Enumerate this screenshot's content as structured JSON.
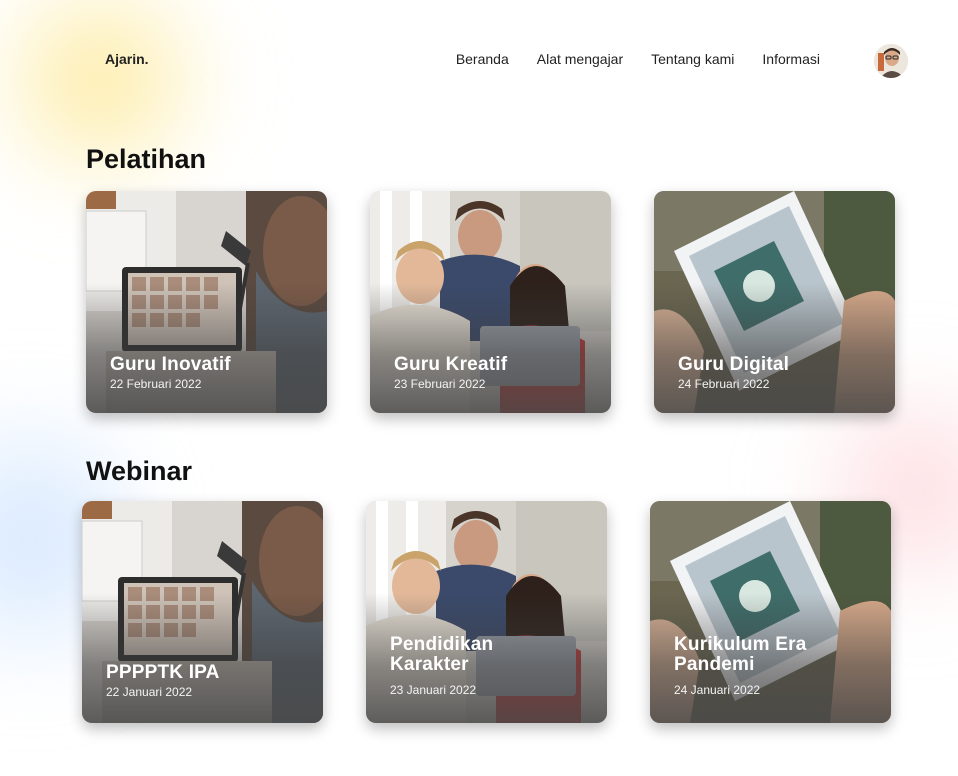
{
  "nav": {
    "logo": "Ajarin.",
    "items": [
      {
        "label": "Beranda"
      },
      {
        "label": "Alat mengajar"
      },
      {
        "label": "Tentang kami"
      },
      {
        "label": "Informasi"
      }
    ]
  },
  "pelatihan": {
    "title": "Pelatihan",
    "cards": [
      {
        "title": "Guru Inovatif",
        "date": "22 Februari 2022",
        "scene": "laptop-video-call"
      },
      {
        "title": "Guru Kreatif",
        "date": "23 Februari 2022",
        "scene": "students-laptop"
      },
      {
        "title": "Guru Digital",
        "date": "24 Februari 2022",
        "scene": "hands-tablet"
      }
    ]
  },
  "webinar": {
    "title": "Webinar",
    "cards": [
      {
        "title": "PPPPTK IPA",
        "date": "22 Januari 2022",
        "scene": "laptop-video-call"
      },
      {
        "title": "Pendidikan\nKarakter",
        "date": "23 Januari 2022",
        "scene": "students-laptop"
      },
      {
        "title": "Kurikulum Era\nPandemi",
        "date": "24 Januari 2022",
        "scene": "hands-tablet"
      }
    ]
  }
}
